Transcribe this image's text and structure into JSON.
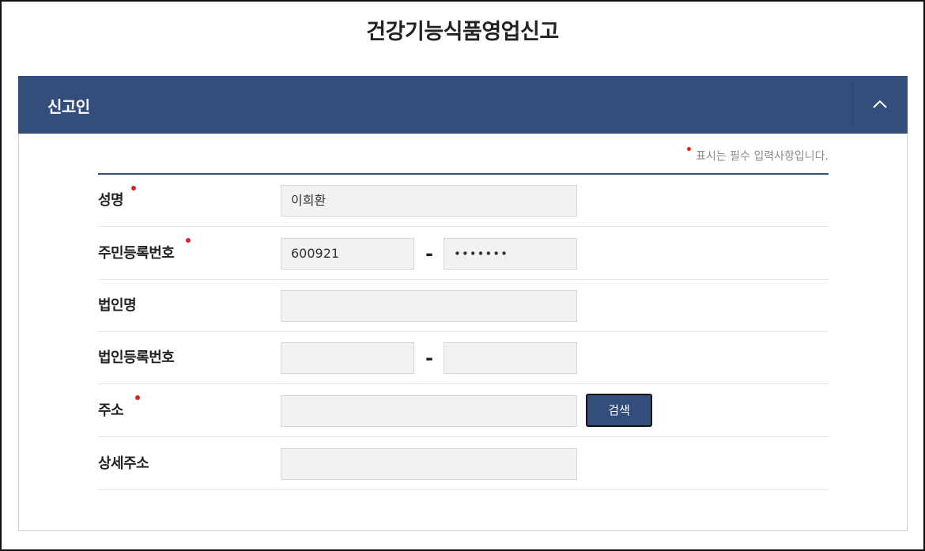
{
  "page": {
    "title": "건강기능식품영업신고"
  },
  "section": {
    "title": "신고인",
    "collapse_icon": "chevron-up-icon",
    "required_note": "표시는 필수 입력사항입니다."
  },
  "form": {
    "name": {
      "label": "성명",
      "value": "이희환",
      "required": true
    },
    "resident_no": {
      "label": "주민등록번호",
      "front": "600921",
      "back": "•••••••",
      "separator": "-",
      "required": true
    },
    "corp_name": {
      "label": "법인명",
      "value": ""
    },
    "corp_reg_no": {
      "label": "법인등록번호",
      "front": "",
      "back": "",
      "separator": "-"
    },
    "address": {
      "label": "주소",
      "value": "",
      "search_label": "검색",
      "required": true
    },
    "address_detail": {
      "label": "상세주소",
      "value": ""
    }
  },
  "colors": {
    "header_bg": "#334e7a",
    "required_dot": "#e02020",
    "field_bg": "#f2f2f2"
  }
}
